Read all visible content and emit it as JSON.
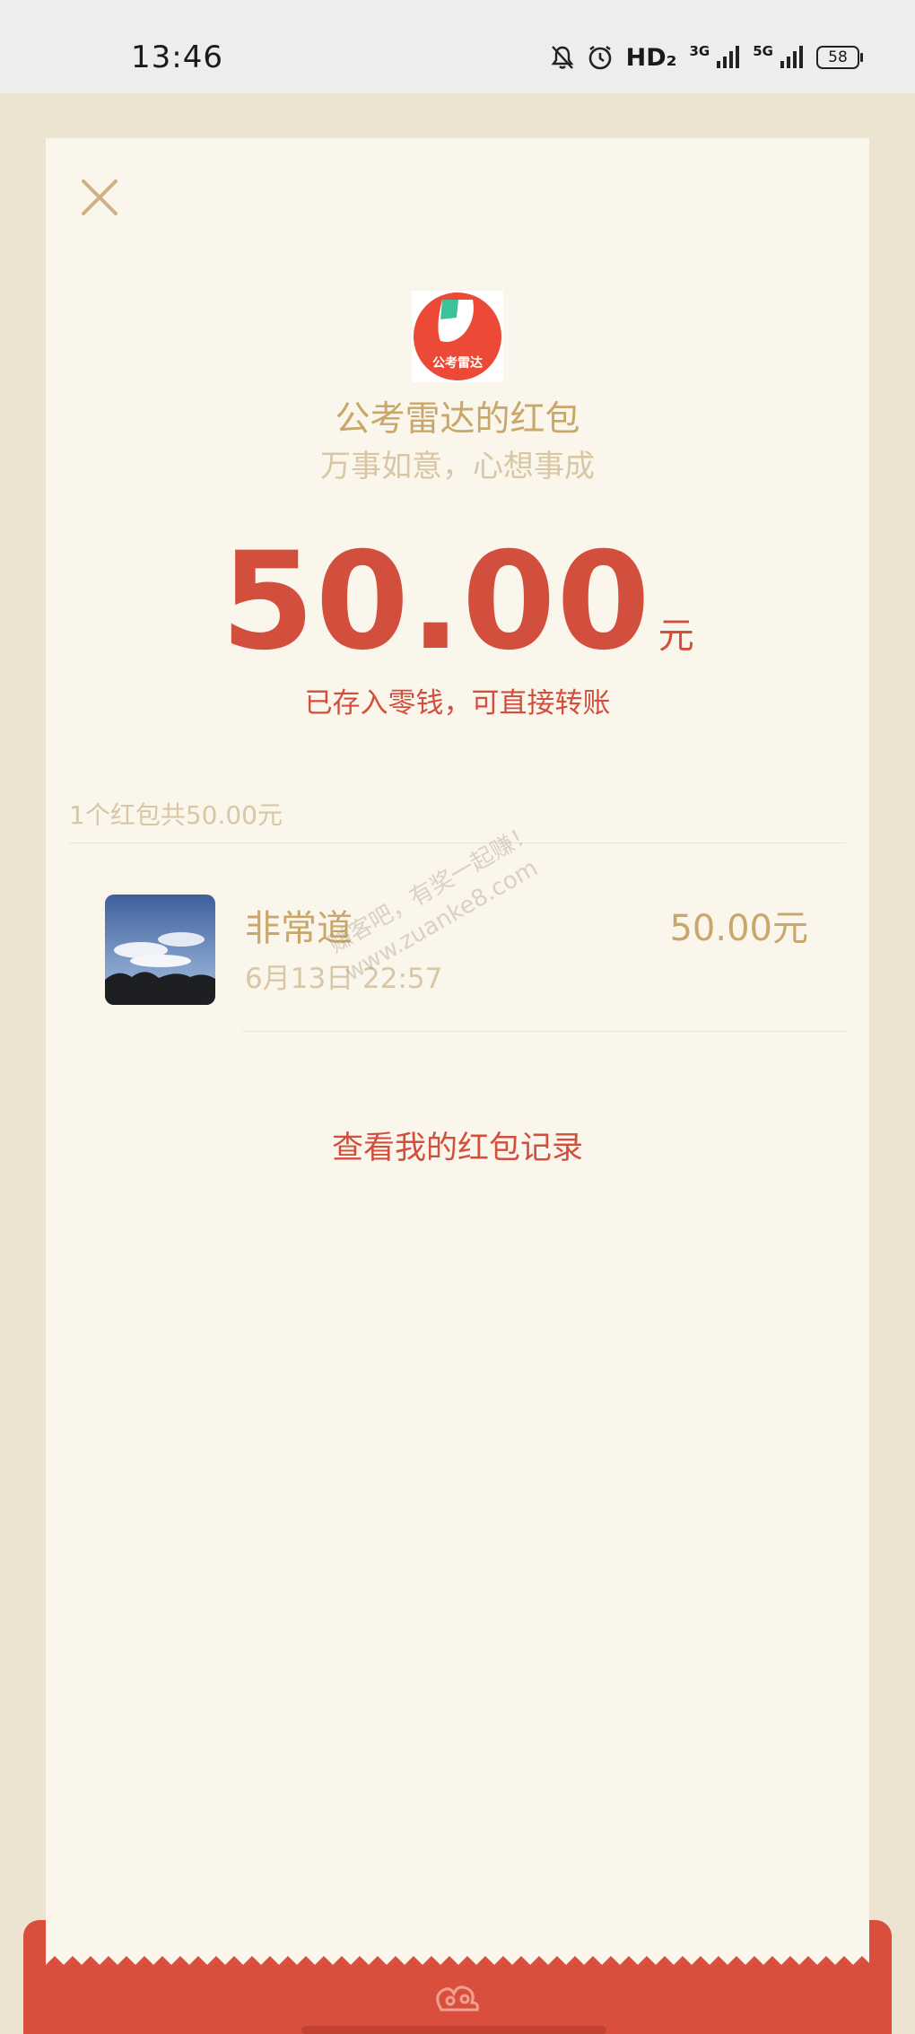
{
  "status_bar": {
    "time": "13:46",
    "hd_label": "HD₂",
    "net1_label": "3G",
    "net2_label": "5G",
    "battery_level": "58",
    "icons": [
      "mute-bell-icon",
      "alarm-icon",
      "signal-icon",
      "signal-icon",
      "battery-icon"
    ]
  },
  "packet": {
    "logo_text": "公考雷达",
    "title": "公考雷达的红包",
    "blessing": "万事如意，心想事成",
    "amount": "50.00",
    "unit": "元",
    "stored_note": "已存入零钱，可直接转账"
  },
  "summary": "1个红包共50.00元",
  "receivers": [
    {
      "name": "非常道",
      "time": "6月13日  22:57",
      "amount": "50.00元"
    }
  ],
  "record_link": "查看我的红包记录",
  "watermark": {
    "line1": "赚客吧，有奖一起赚！",
    "line2": "www.zuanke8.com"
  },
  "colors": {
    "red": "#d34f3d",
    "gold": "#c9a76a",
    "light_gold": "#d8c6a4",
    "card_bg": "#faf6ec",
    "page_bg": "#ece4d0"
  }
}
